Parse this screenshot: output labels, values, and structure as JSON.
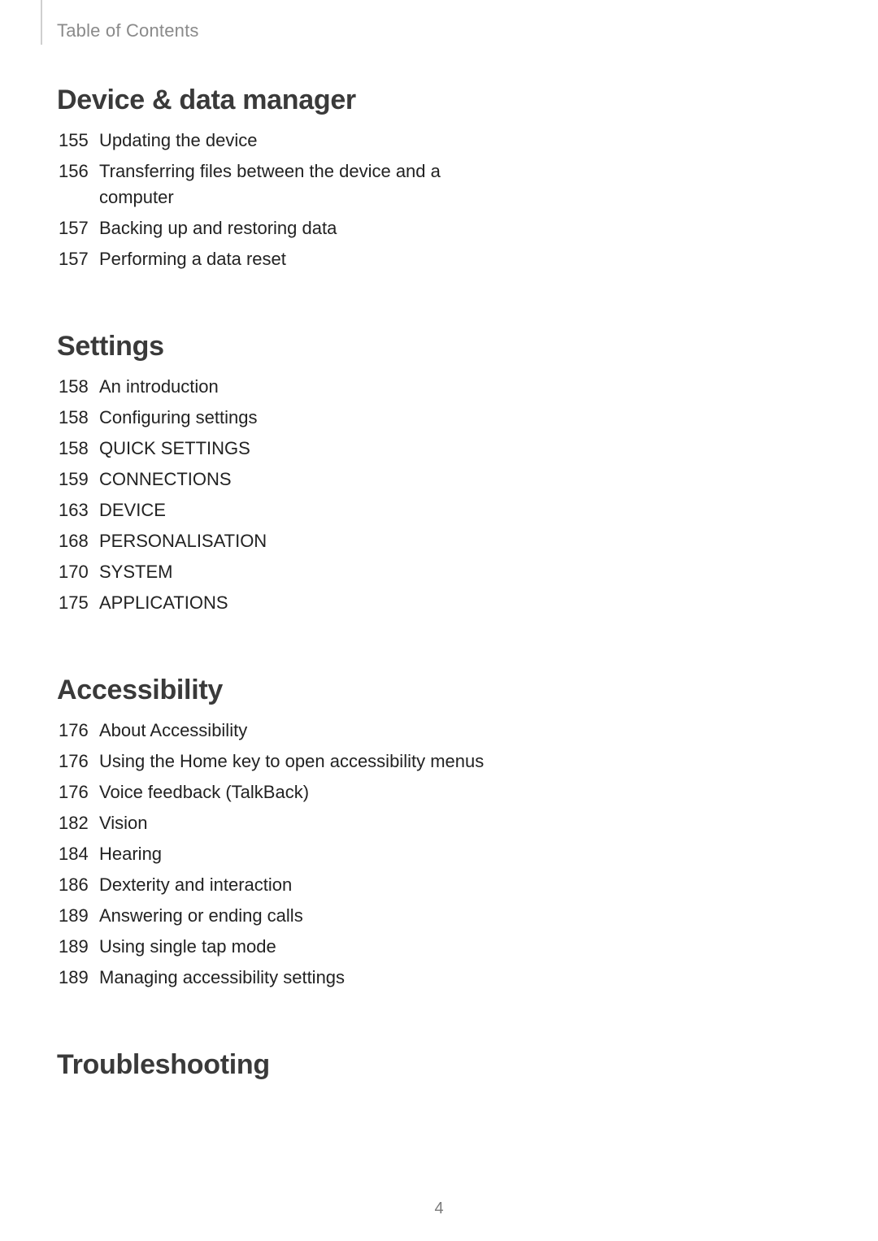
{
  "header": {
    "label": "Table of Contents"
  },
  "page_number": "4",
  "sections": [
    {
      "title": "Device & data manager",
      "items": [
        {
          "page": "155",
          "text": "Updating the device"
        },
        {
          "page": "156",
          "text": "Transferring files between the device and a computer"
        },
        {
          "page": "157",
          "text": "Backing up and restoring data"
        },
        {
          "page": "157",
          "text": "Performing a data reset"
        }
      ]
    },
    {
      "title": "Settings",
      "items": [
        {
          "page": "158",
          "text": "An introduction"
        },
        {
          "page": "158",
          "text": "Configuring settings"
        },
        {
          "page": "158",
          "text": "QUICK SETTINGS"
        },
        {
          "page": "159",
          "text": "CONNECTIONS"
        },
        {
          "page": "163",
          "text": "DEVICE"
        },
        {
          "page": "168",
          "text": "PERSONALISATION"
        },
        {
          "page": "170",
          "text": "SYSTEM"
        },
        {
          "page": "175",
          "text": "APPLICATIONS"
        }
      ]
    },
    {
      "title": "Accessibility",
      "items": [
        {
          "page": "176",
          "text": "About Accessibility"
        },
        {
          "page": "176",
          "text": "Using the Home key to open accessibility menus"
        },
        {
          "page": "176",
          "text": "Voice feedback (TalkBack)"
        },
        {
          "page": "182",
          "text": "Vision"
        },
        {
          "page": "184",
          "text": "Hearing"
        },
        {
          "page": "186",
          "text": "Dexterity and interaction"
        },
        {
          "page": "189",
          "text": "Answering or ending calls"
        },
        {
          "page": "189",
          "text": "Using single tap mode"
        },
        {
          "page": "189",
          "text": "Managing accessibility settings"
        }
      ]
    },
    {
      "title": "Troubleshooting",
      "items": []
    }
  ]
}
